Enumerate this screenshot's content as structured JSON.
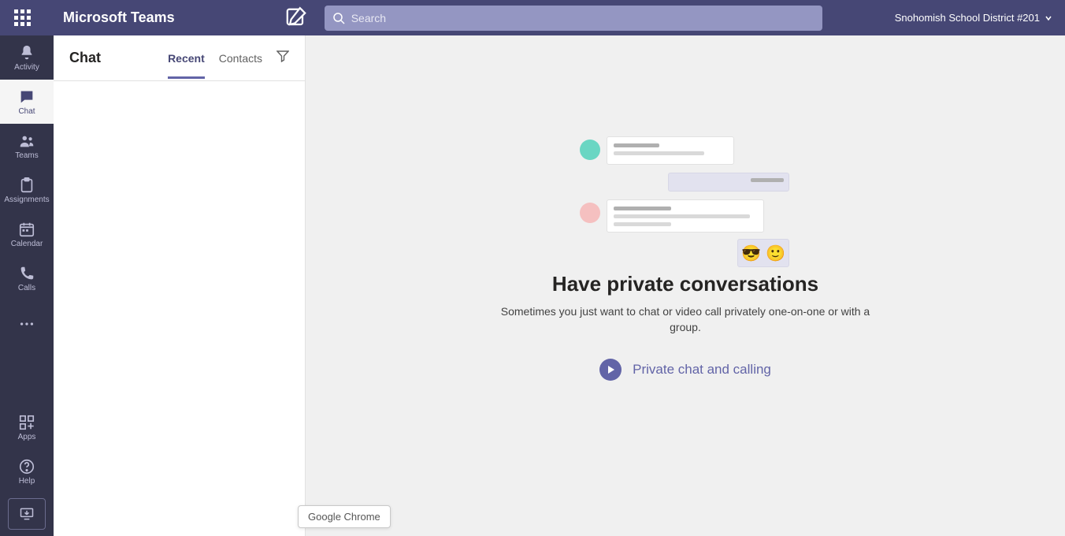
{
  "topbar": {
    "brand": "Microsoft Teams",
    "search_placeholder": "Search",
    "tenant_name": "Snohomish School District #201"
  },
  "rail": {
    "items": [
      {
        "id": "activity",
        "label": "Activity"
      },
      {
        "id": "chat",
        "label": "Chat"
      },
      {
        "id": "teams",
        "label": "Teams"
      },
      {
        "id": "assignments",
        "label": "Assignments"
      },
      {
        "id": "calendar",
        "label": "Calendar"
      },
      {
        "id": "calls",
        "label": "Calls"
      }
    ],
    "bottom": [
      {
        "id": "apps",
        "label": "Apps"
      },
      {
        "id": "help",
        "label": "Help"
      }
    ],
    "active_id": "chat"
  },
  "leftpane": {
    "title": "Chat",
    "tabs": [
      {
        "id": "recent",
        "label": "Recent"
      },
      {
        "id": "contacts",
        "label": "Contacts"
      }
    ],
    "active_tab": "recent"
  },
  "empty_state": {
    "title": "Have private conversations",
    "subtitle": "Sometimes you just want to chat or video call privately one-on-one or with a group.",
    "cta_label": "Private chat and calling",
    "emoji1": "😎",
    "emoji2": "🙂"
  },
  "tooltip": {
    "text": "Google Chrome"
  },
  "colors": {
    "brand_purple": "#464775",
    "accent": "#6264a7"
  }
}
